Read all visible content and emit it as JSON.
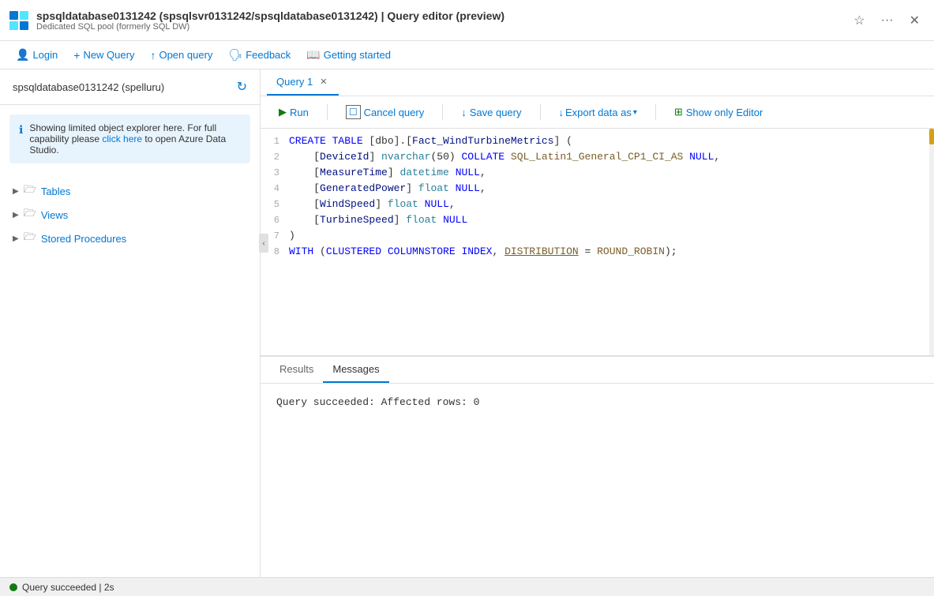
{
  "titlebar": {
    "title": "spsqldatabase0131242 (spsqlsvr0131242/spsqldatabase0131242) | Query editor (preview)",
    "subtitle": "Dedicated SQL pool (formerly SQL DW)"
  },
  "toolbar": {
    "login": "Login",
    "new_query": "New Query",
    "open_query": "Open query",
    "feedback": "Feedback",
    "getting_started": "Getting started"
  },
  "sidebar": {
    "db_name": "spsqldatabase0131242 (spelluru)",
    "info_text": "Showing limited object explorer here. For full capability please click here to open Azure Data Studio.",
    "info_link": "click here",
    "tree_items": [
      {
        "label": "Tables"
      },
      {
        "label": "Views"
      },
      {
        "label": "Stored Procedures"
      }
    ]
  },
  "query_tab": {
    "label": "Query 1"
  },
  "query_toolbar": {
    "run": "Run",
    "cancel": "Cancel query",
    "save": "Save query",
    "export": "Export data as",
    "show_editor": "Show only Editor"
  },
  "code": {
    "lines": [
      {
        "num": "1",
        "content": "CREATE TABLE [dbo].[Fact_WindTurbineMetrics] ("
      },
      {
        "num": "2",
        "content": "    [DeviceId] nvarchar(50) COLLATE SQL_Latin1_General_CP1_CI_AS NULL,"
      },
      {
        "num": "3",
        "content": "    [MeasureTime] datetime NULL,"
      },
      {
        "num": "4",
        "content": "    [GeneratedPower] float NULL,"
      },
      {
        "num": "5",
        "content": "    [WindSpeed] float NULL,"
      },
      {
        "num": "6",
        "content": "    [TurbineSpeed] float NULL"
      },
      {
        "num": "7",
        "content": ")"
      },
      {
        "num": "8",
        "content": "WITH (CLUSTERED COLUMNSTORE INDEX, DISTRIBUTION = ROUND_ROBIN);"
      }
    ]
  },
  "results": {
    "tabs": [
      "Results",
      "Messages"
    ],
    "active_tab": "Messages",
    "message": "Query succeeded: Affected rows: 0"
  },
  "statusbar": {
    "text": "Query succeeded | 2s"
  }
}
